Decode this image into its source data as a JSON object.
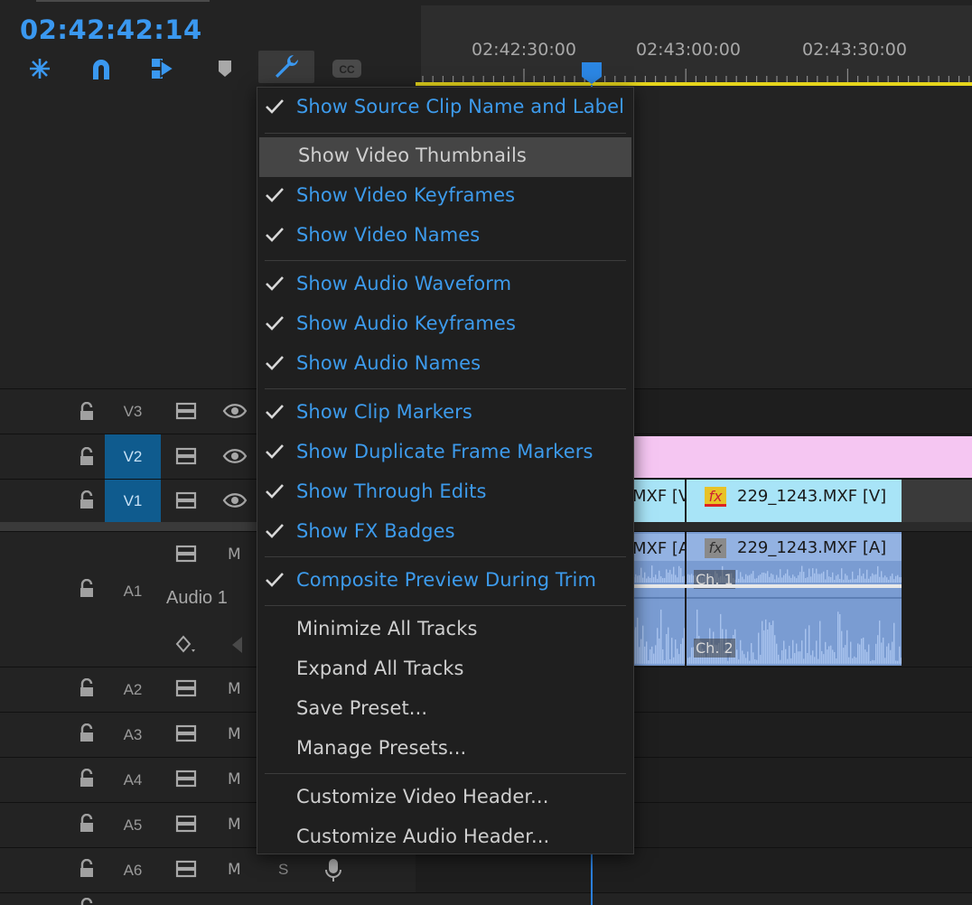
{
  "timecode": "02:42:42:14",
  "ruler": {
    "labels": [
      "02:42:30:00",
      "02:43:00:00",
      "02:43:30:00"
    ]
  },
  "toolbar": {
    "tools": [
      "snap-insert-icon",
      "magnet-icon",
      "linked-selection-icon",
      "add-marker-icon",
      "wrench-icon",
      "closed-captions-icon"
    ],
    "cc_label": "CC"
  },
  "menu": {
    "items": [
      {
        "label": "Show Source Clip Name and Label",
        "checked": true
      },
      {
        "label": "Show Video Thumbnails",
        "checked": false
      },
      {
        "label": "Show Video Keyframes",
        "checked": true
      },
      {
        "label": "Show Video Names",
        "checked": true
      },
      {
        "label": "Show Audio Waveform",
        "checked": true
      },
      {
        "label": "Show Audio Keyframes",
        "checked": true
      },
      {
        "label": "Show Audio Names",
        "checked": true
      },
      {
        "label": "Show Clip Markers",
        "checked": true
      },
      {
        "label": "Show Duplicate Frame Markers",
        "checked": true
      },
      {
        "label": "Show Through Edits",
        "checked": true
      },
      {
        "label": "Show FX Badges",
        "checked": true
      },
      {
        "label": "Composite Preview During Trim",
        "checked": true
      },
      {
        "label": "Minimize All Tracks",
        "checked": false
      },
      {
        "label": "Expand All Tracks",
        "checked": false
      },
      {
        "label": "Save Preset...",
        "checked": false
      },
      {
        "label": "Manage Presets...",
        "checked": false
      },
      {
        "label": "Customize Video Header...",
        "checked": false
      },
      {
        "label": "Customize Audio Header...",
        "checked": false
      }
    ]
  },
  "tracks": {
    "v3": "V3",
    "v2": "V2",
    "v1": "V1",
    "a1": "A1",
    "a1_name": "Audio 1",
    "a2": "A2",
    "a3": "A3",
    "a4": "A4",
    "a5": "A5",
    "a6": "A6",
    "mute_label": "M",
    "solo_label": "S"
  },
  "clips": {
    "v1_left": "MXF [V",
    "v1_right": "229_1243.MXF [V]",
    "a1_left": "MXF [A",
    "a1_right": "229_1243.MXF [A]",
    "ch1": "Ch. 1",
    "ch2": "Ch. 2",
    "fx": "fx"
  },
  "colors": {
    "accent": "#3a98f0",
    "video_clip": "#a8e4f7",
    "audio_clip": "#7a9cd2",
    "adjustment_clip": "#f5c6f2",
    "selected_track": "#0f5b8e"
  }
}
